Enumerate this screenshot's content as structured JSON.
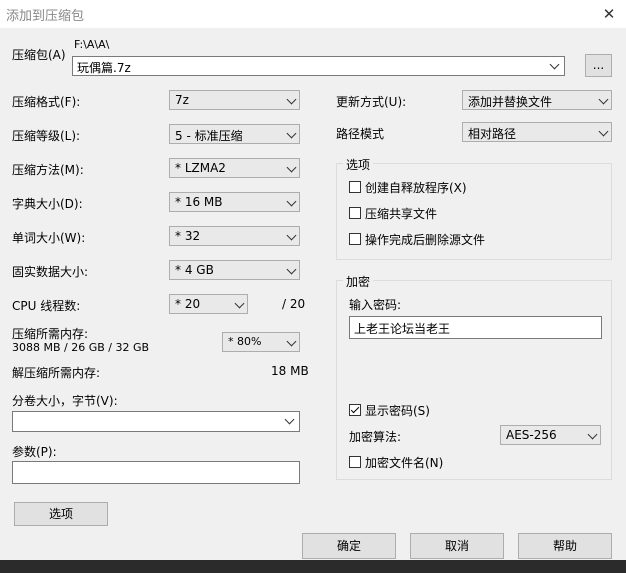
{
  "window": {
    "title": "添加到压缩包",
    "close_glyph": "✕"
  },
  "archive": {
    "label": "压缩包(A)",
    "path": "F:\\A\\A\\",
    "filename": "玩偶篇.7z",
    "browse_label": "..."
  },
  "left": {
    "format": {
      "label": "压缩格式(F):",
      "value": "7z"
    },
    "level": {
      "label": "压缩等级(L):",
      "value": "5 - 标准压缩"
    },
    "method": {
      "label": "压缩方法(M):",
      "value": "* LZMA2"
    },
    "dict": {
      "label": "字典大小(D):",
      "value": "* 16 MB"
    },
    "word": {
      "label": "单词大小(W):",
      "value": "* 32"
    },
    "solid": {
      "label": "固实数据大小:",
      "value": "* 4 GB"
    },
    "threads": {
      "label": "CPU 线程数:",
      "value": "* 20",
      "total": "/ 20"
    },
    "memory": {
      "label": "压缩所需内存:",
      "detail": "3088 MB / 26 GB / 32 GB",
      "value": "* 80%"
    },
    "decomp": {
      "label": "解压缩所需内存:",
      "value": "18 MB"
    },
    "split": {
      "label": "分卷大小，字节(V):",
      "value": ""
    },
    "params": {
      "label": "参数(P):",
      "value": ""
    },
    "options_button": "选项"
  },
  "right": {
    "update": {
      "label": "更新方式(U):",
      "value": "添加并替换文件"
    },
    "pathmode": {
      "label": "路径模式",
      "value": "相对路径"
    },
    "options_group": {
      "title": "选项",
      "sfx": "创建自释放程序(X)",
      "shared": "压缩共享文件",
      "delete": "操作完成后删除源文件"
    },
    "encrypt": {
      "title": "加密",
      "pwd_label": "输入密码:",
      "pwd_value": "上老王论坛当老王",
      "show_pwd": "显示密码(S)",
      "method_label": "加密算法:",
      "method_value": "AES-256",
      "encrypt_names": "加密文件名(N)"
    }
  },
  "buttons": {
    "ok": "确定",
    "cancel": "取消",
    "help": "帮助"
  }
}
